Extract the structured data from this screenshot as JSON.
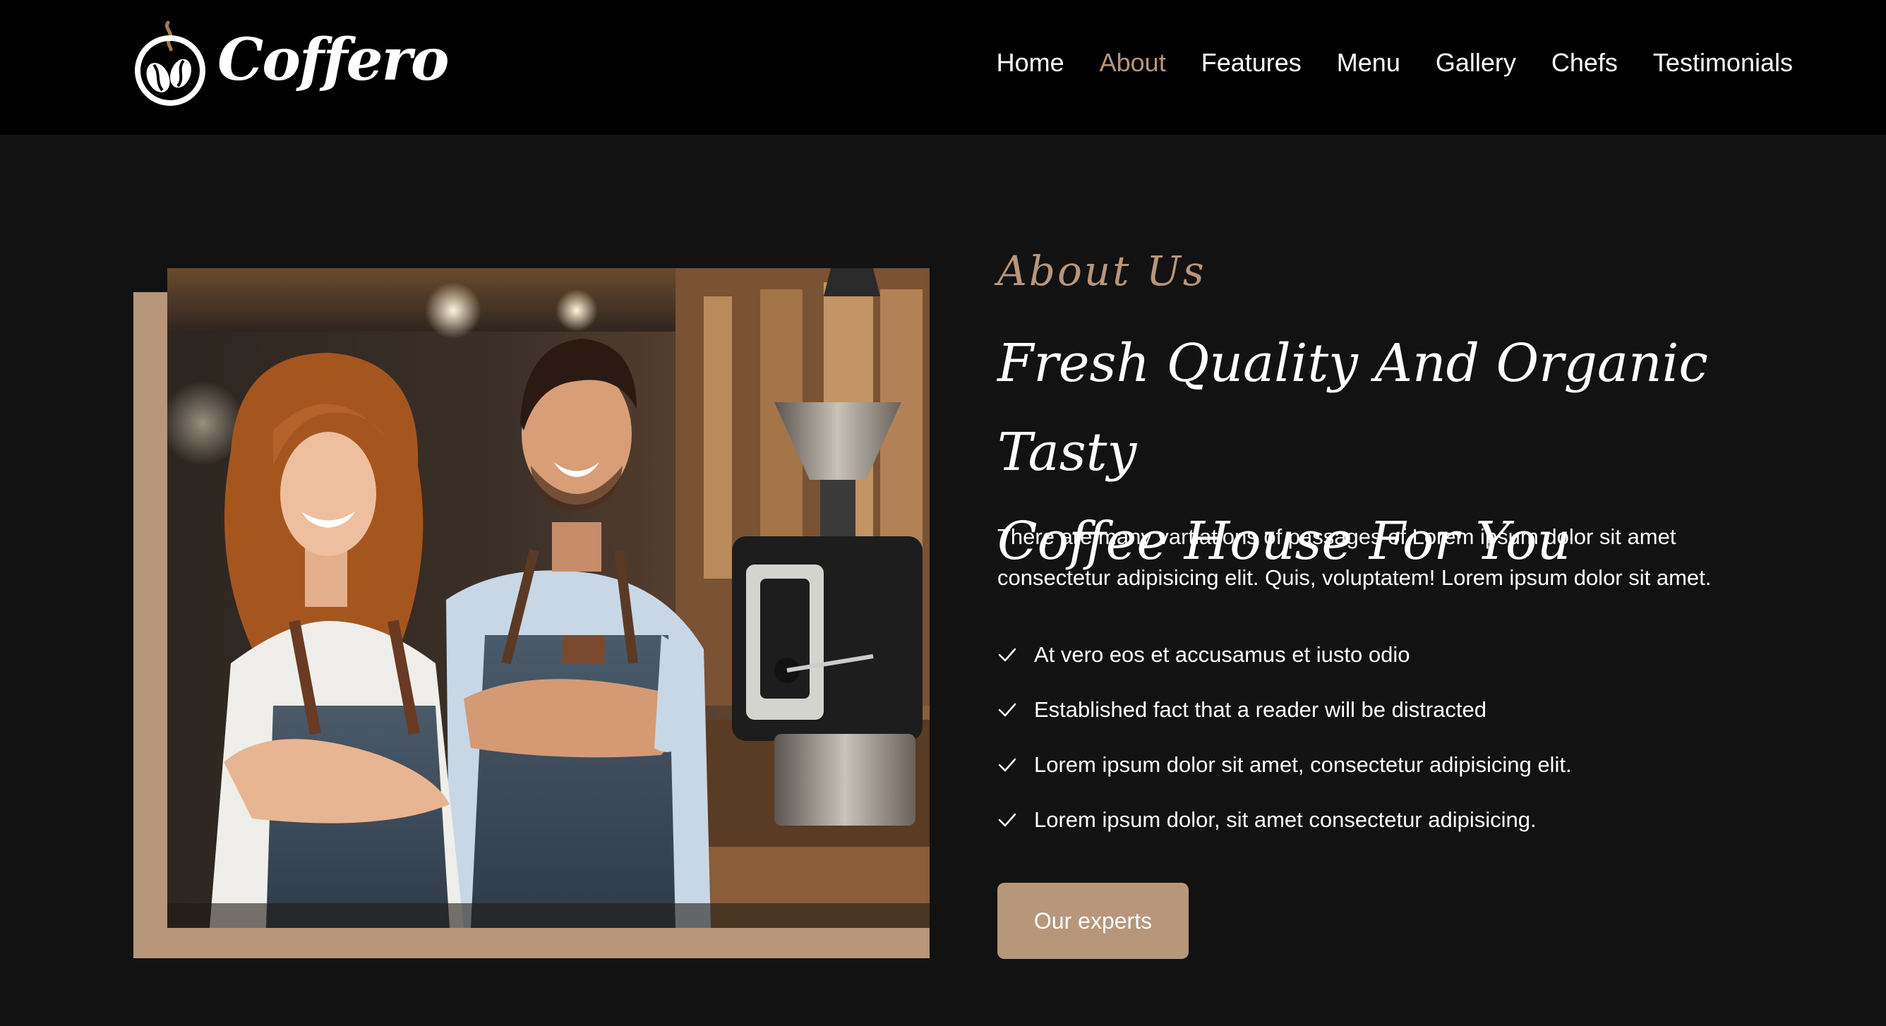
{
  "brand": {
    "name": "Coffero",
    "logo_icon": "coffee-beans-icon"
  },
  "nav": {
    "items": [
      {
        "label": "Home"
      },
      {
        "label": "About"
      },
      {
        "label": "Features"
      },
      {
        "label": "Menu"
      },
      {
        "label": "Gallery"
      },
      {
        "label": "Chefs"
      },
      {
        "label": "Testimonials"
      }
    ],
    "active": "About"
  },
  "about": {
    "eyebrow": "About Us",
    "headline_line1": "Fresh Quality And Organic Tasty",
    "headline_line2": "Coffee House For You",
    "description": "There are many vartiations of passages of Lorem ipsum dolor sit amet consectetur adipisicing elit. Quis, voluptatem! Lorem ipsum dolor sit amet.",
    "checklist": [
      {
        "text": "At vero eos et accusamus et iusto odio",
        "icon": "check-icon"
      },
      {
        "text": "Established fact that a reader will be distracted",
        "icon": "check-icon"
      },
      {
        "text": "Lorem ipsum dolor sit amet, consectetur adipisicing elit.",
        "icon": "check-icon"
      },
      {
        "text": "Lorem ipsum dolor, sit amet consectetur adipisicing.",
        "icon": "check-icon"
      }
    ],
    "button_label": "Our experts",
    "image_subject": "two-baristas-photo"
  },
  "colors": {
    "accent": "#b8967a",
    "header_bg": "#000000",
    "page_bg": "#121212",
    "text": "#ffffff"
  }
}
